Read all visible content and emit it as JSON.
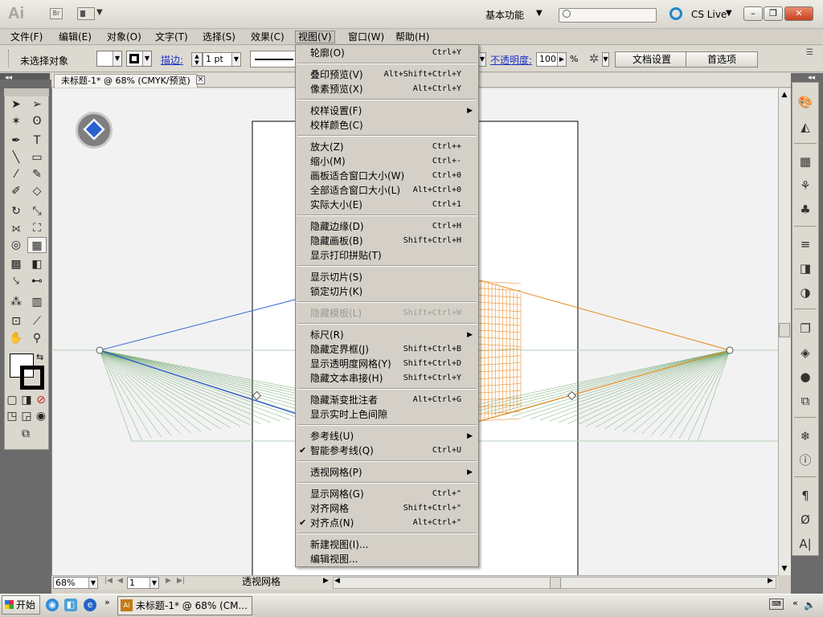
{
  "titlebar": {
    "app_logo": "Ai",
    "bridge": "Br",
    "workspace": "基本功能",
    "search_placeholder": "",
    "cslive": "CS Live",
    "btn_min": "–",
    "btn_max": "❐",
    "btn_close": "✕"
  },
  "menubar": [
    "文件(F)",
    "编辑(E)",
    "对象(O)",
    "文字(T)",
    "选择(S)",
    "效果(C)",
    "视图(V)",
    "窗口(W)",
    "帮助(H)"
  ],
  "control": {
    "no_selection": "未选择对象",
    "stroke_label": "描边:",
    "stroke_weight": "1 pt",
    "opacity_label": "不透明度:",
    "opacity_value": "100",
    "opacity_unit": "%",
    "doc_setup": "文档设置",
    "prefs": "首选项"
  },
  "tab": {
    "title": "未标题-1* @ 68% (CMYK/预览)",
    "close": "×"
  },
  "status": {
    "zoom": "68%",
    "page": "1",
    "text": "透视网格"
  },
  "taskbar": {
    "start": "开始",
    "app_icon": "Ai",
    "task": "未标题-1* @ 68% (CM..."
  },
  "view_menu": [
    {
      "label": "轮廓(O)",
      "shortcut": "Ctrl+Y"
    },
    {
      "sep": true
    },
    {
      "label": "叠印预览(V)",
      "shortcut": "Alt+Shift+Ctrl+Y"
    },
    {
      "label": "像素预览(X)",
      "shortcut": "Alt+Ctrl+Y"
    },
    {
      "sep": true
    },
    {
      "label": "校样设置(F)",
      "submenu": true
    },
    {
      "label": "校样颜色(C)"
    },
    {
      "sep": true
    },
    {
      "label": "放大(Z)",
      "shortcut": "Ctrl++"
    },
    {
      "label": "缩小(M)",
      "shortcut": "Ctrl+-"
    },
    {
      "label": "画板适合窗口大小(W)",
      "shortcut": "Ctrl+0"
    },
    {
      "label": "全部适合窗口大小(L)",
      "shortcut": "Alt+Ctrl+0"
    },
    {
      "label": "实际大小(E)",
      "shortcut": "Ctrl+1"
    },
    {
      "sep": true
    },
    {
      "label": "隐藏边缘(D)",
      "shortcut": "Ctrl+H"
    },
    {
      "label": "隐藏画板(B)",
      "shortcut": "Shift+Ctrl+H"
    },
    {
      "label": "显示打印拼贴(T)"
    },
    {
      "sep": true
    },
    {
      "label": "显示切片(S)"
    },
    {
      "label": "锁定切片(K)"
    },
    {
      "sep": true
    },
    {
      "label": "隐藏模板(L)",
      "shortcut": "Shift+Ctrl+W",
      "disabled": true
    },
    {
      "sep": true
    },
    {
      "label": "标尺(R)",
      "submenu": true
    },
    {
      "label": "隐藏定界框(J)",
      "shortcut": "Shift+Ctrl+B"
    },
    {
      "label": "显示透明度网格(Y)",
      "shortcut": "Shift+Ctrl+D"
    },
    {
      "label": "隐藏文本串接(H)",
      "shortcut": "Shift+Ctrl+Y"
    },
    {
      "sep": true
    },
    {
      "label": "隐藏渐变批注者",
      "shortcut": "Alt+Ctrl+G"
    },
    {
      "label": "显示实时上色间隙"
    },
    {
      "sep": true
    },
    {
      "label": "参考线(U)",
      "submenu": true
    },
    {
      "label": "智能参考线(Q)",
      "shortcut": "Ctrl+U",
      "checked": true
    },
    {
      "sep": true
    },
    {
      "label": "透视网格(P)",
      "submenu": true
    },
    {
      "sep": true
    },
    {
      "label": "显示网格(G)",
      "shortcut": "Ctrl+\""
    },
    {
      "label": "对齐网格",
      "shortcut": "Shift+Ctrl+\""
    },
    {
      "label": "对齐点(N)",
      "shortcut": "Alt+Ctrl+\"",
      "checked": true
    },
    {
      "sep": true
    },
    {
      "label": "新建视图(I)..."
    },
    {
      "label": "编辑视图..."
    }
  ]
}
